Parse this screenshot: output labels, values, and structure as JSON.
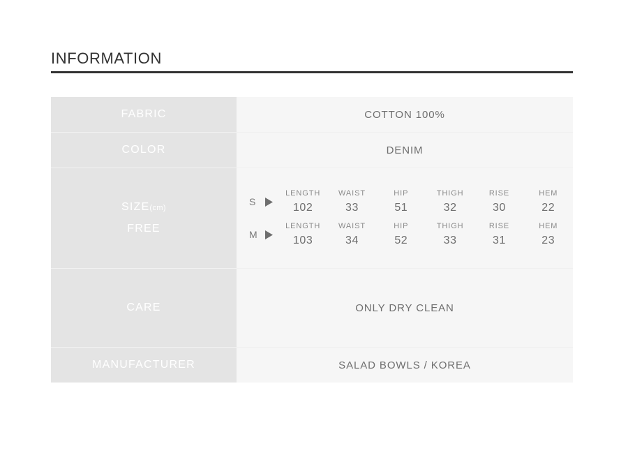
{
  "header": {
    "title": "INFORMATION"
  },
  "table": {
    "rows": [
      {
        "label": "FABRIC",
        "value": "COTTON 100%"
      },
      {
        "label": "COLOR",
        "value": "DENIM"
      },
      {
        "label": "SIZE",
        "label_unit": "(cm)",
        "label_sub": "FREE"
      },
      {
        "label": "CARE",
        "value": "ONLY DRY CLEAN"
      },
      {
        "label": "MANUFACTURER",
        "value": "SALAD BOWLS / KOREA"
      }
    ]
  },
  "size_chart": {
    "marker_icon": "play-triangle-icon",
    "columns": [
      "LENGTH",
      "WAIST",
      "HIP",
      "THIGH",
      "RISE",
      "HEM"
    ],
    "rows": [
      {
        "size": "S",
        "values": [
          "102",
          "33",
          "51",
          "32",
          "30",
          "22"
        ]
      },
      {
        "size": "M",
        "values": [
          "103",
          "34",
          "52",
          "33",
          "31",
          "23"
        ]
      }
    ]
  },
  "colors": {
    "rule": "#333333",
    "label_cell_bg": "#e4e4e4",
    "value_cell_bg": "#f6f6f6",
    "label_text": "#ffffff",
    "value_text": "#6e6e6e"
  }
}
